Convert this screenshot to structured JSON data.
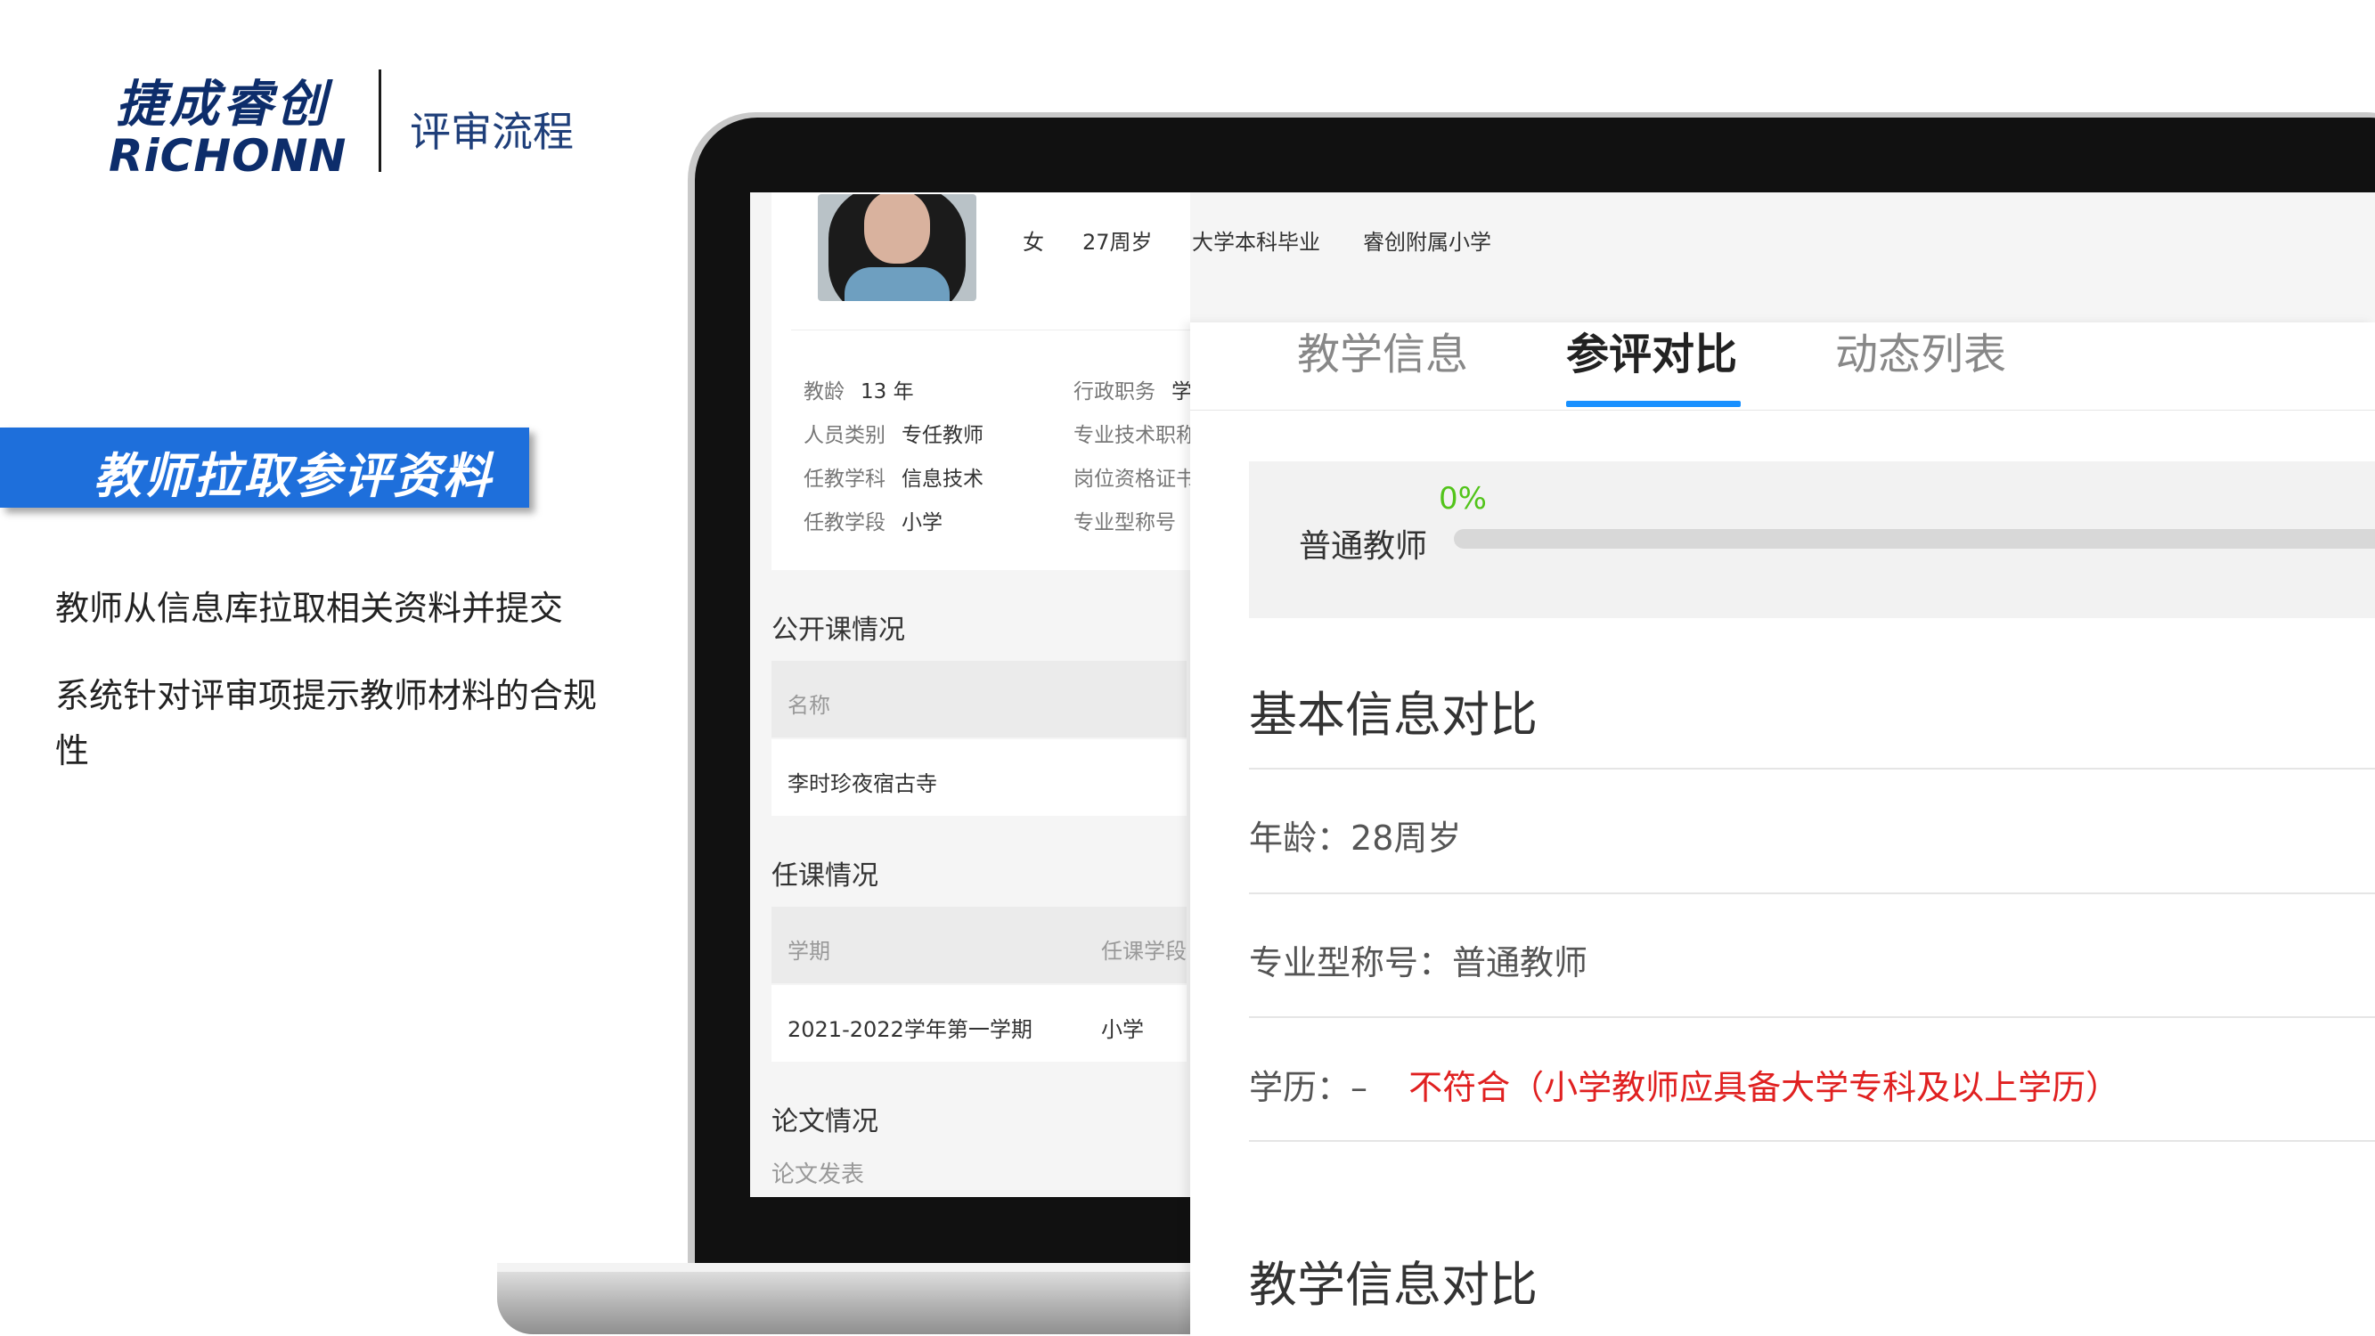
{
  "brand": {
    "name_cn": "捷成睿创",
    "name_en": "RiCHONN",
    "section": "评审流程"
  },
  "left": {
    "banner": "教师拉取参评资料",
    "desc_1": "教师从信息库拉取相关资料并提交",
    "desc_2": "系统针对评审项提示教师材料的合规性"
  },
  "profile": {
    "gender": "女",
    "age": "27周岁",
    "education": "大学本科毕业",
    "school": "睿创附属小学",
    "fields_left": [
      {
        "label": "教龄",
        "value": "13 年"
      },
      {
        "label": "人员类别",
        "value": "专任教师"
      },
      {
        "label": "任教学科",
        "value": "信息技术"
      },
      {
        "label": "任教学段",
        "value": "小学"
      }
    ],
    "fields_right": [
      {
        "label": "行政职务",
        "value": "学"
      },
      {
        "label": "专业技术职称",
        "value": ""
      },
      {
        "label": "岗位资格证书",
        "value": ""
      },
      {
        "label": "专业型称号",
        "value": ""
      }
    ],
    "open_class": {
      "title": "公开课情况",
      "header": "名称",
      "rows": [
        "李时珍夜宿古寺"
      ]
    },
    "course": {
      "title": "任课情况",
      "headers": [
        "学期",
        "任课学段"
      ],
      "rows": [
        [
          "2021-2022学年第一学期",
          "小学"
        ]
      ]
    },
    "paper": {
      "title": "论文情况",
      "sub": "论文发表"
    }
  },
  "compare": {
    "tabs": [
      "教学信息",
      "参评对比",
      "动态列表"
    ],
    "active_tab": 1,
    "progress": {
      "label": "普通教师",
      "percent_text": "0%",
      "percent": 0
    },
    "basic_title": "基本信息对比",
    "rows": [
      {
        "label": "年龄：",
        "value": "28周岁"
      },
      {
        "label": "专业型称号：",
        "value": "普通教师"
      },
      {
        "label": "学历：",
        "value": "–",
        "warning": "不符合（小学教师应具备大学专科及以上学历）"
      }
    ],
    "teaching_title": "教学信息对比"
  },
  "colors": {
    "brand": "#0d2d6b",
    "banner": "#1e6fdb",
    "accent": "#1890ff",
    "progress": "#52c41a",
    "warning": "#e02020"
  }
}
